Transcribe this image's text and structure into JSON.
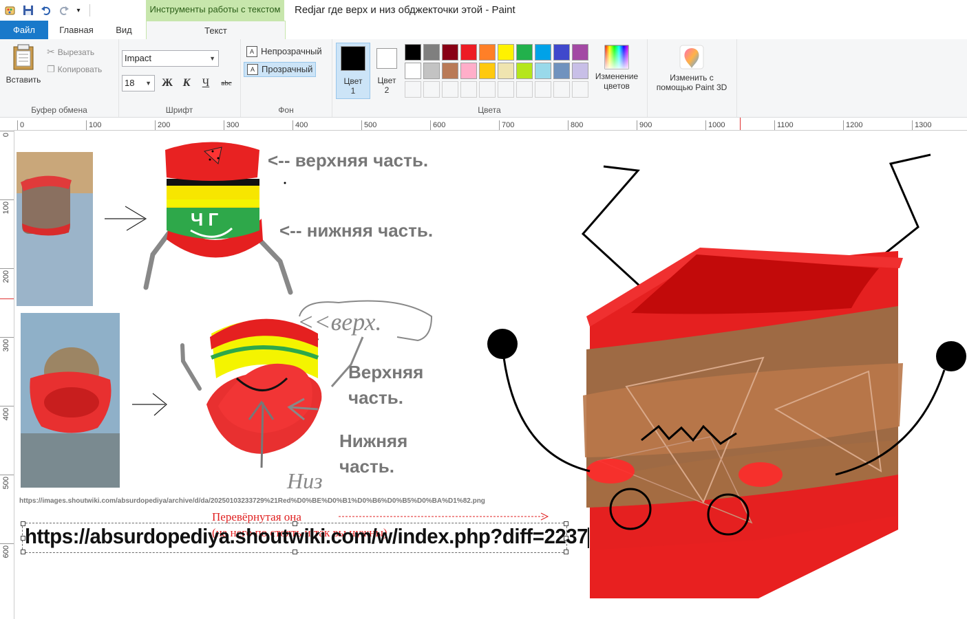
{
  "window": {
    "title": "Redjar где верх и низ обджекточки этой - Paint",
    "context_tab_title": "Инструменты работы с текстом"
  },
  "tabs": {
    "file": "Файл",
    "home": "Главная",
    "view": "Вид",
    "text": "Текст"
  },
  "clipboard": {
    "paste": "Вставить",
    "cut": "Вырезать",
    "copy": "Копировать",
    "label": "Буфер обмена"
  },
  "font": {
    "family": "Impact",
    "size": "18",
    "bold": "Ж",
    "italic": "К",
    "underline": "Ч",
    "strike": "abc",
    "label": "Шрифт"
  },
  "background": {
    "opaque": "Непрозрачный",
    "transparent": "Прозрачный",
    "selected": "transparent",
    "label": "Фон"
  },
  "colors": {
    "color1_label": "Цвет",
    "color1_num": "1",
    "color2_label": "Цвет",
    "color2_num": "2",
    "color1": "#000000",
    "color2": "#ffffff",
    "edit_label_1": "Изменение",
    "edit_label_2": "цветов",
    "label": "Цвета",
    "palette": [
      "#000000",
      "#7f7f7f",
      "#880015",
      "#ed1c24",
      "#ff7f27",
      "#fff200",
      "#22b14c",
      "#00a2e8",
      "#3f48cc",
      "#a349a4",
      "#ffffff",
      "#c3c3c3",
      "#b97a57",
      "#ffaec9",
      "#ffc90e",
      "#efe4b0",
      "#b5e61d",
      "#99d9ea",
      "#7092be",
      "#c8bfe7",
      "",
      "",
      "",
      "",
      "",
      "",
      "",
      "",
      "",
      ""
    ]
  },
  "paint3d": {
    "line1": "Изменить с",
    "line2": "помощью Paint 3D"
  },
  "ruler": {
    "h_labels": [
      "0",
      "100",
      "200",
      "300",
      "400",
      "500",
      "600",
      "700",
      "800",
      "900",
      "1000",
      "1100",
      "1200",
      "1300"
    ],
    "v_labels": [
      "0",
      "100",
      "200",
      "300",
      "400",
      "500",
      "600"
    ]
  },
  "canvas": {
    "annot_top": "<-- верхняя часть.",
    "annot_bottom": "<-- нижняя часть.",
    "annot_upper_a": "Верхняя",
    "annot_upper_b": "часть.",
    "annot_lower_a": "Нижняя",
    "annot_lower_b": "часть.",
    "handwritten_top": "<<верх.",
    "handwritten_bottom": "Низ",
    "face_text": "Ч Г",
    "small_url": "https://images.shoutwiki.com/absurdopediya/archive/d/da/20250103233729%21Red%D0%BE%D0%B1%D0%B6%D0%B5%D0%BA%D1%82.png",
    "red_note_1": "Перевёрнутая она",
    "red_note_2": "(на него по стоять и так вы нужны)",
    "text_input": "https://absurdopediya.shoutwiki.com/w/index.php?diff=2237"
  }
}
